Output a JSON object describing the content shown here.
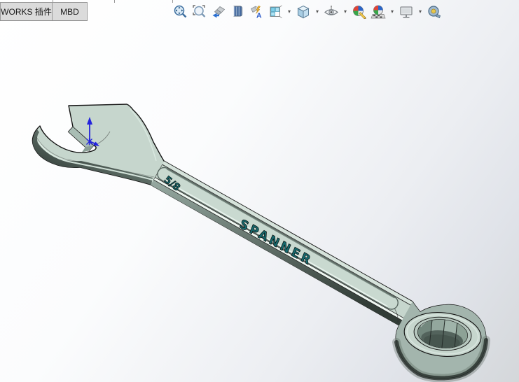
{
  "tab_bar": {
    "tabs": [
      {
        "label": "WORKS 插件"
      },
      {
        "label": "MBD"
      }
    ]
  },
  "toolbar": {
    "caret_glyph": "▾",
    "buttons": [
      {
        "icon": "zoom-to-fit-icon",
        "dropdown": false
      },
      {
        "icon": "zoom-to-area-icon",
        "dropdown": false
      },
      {
        "icon": "previous-view-icon",
        "dropdown": false
      },
      {
        "icon": "section-view-icon",
        "dropdown": false
      },
      {
        "icon": "dynamic-annotation-views-icon",
        "dropdown": false
      },
      {
        "icon": "view-orientation-icon",
        "dropdown": true
      },
      {
        "icon": "display-style-icon",
        "dropdown": true
      },
      {
        "icon": "hide-show-items-icon",
        "dropdown": true
      },
      {
        "icon": "edit-appearance-icon",
        "dropdown": false
      },
      {
        "icon": "apply-scene-icon",
        "dropdown": true
      },
      {
        "icon": "view-settings-icon",
        "dropdown": true
      },
      {
        "icon": "measure-tape-icon",
        "dropdown": false
      }
    ]
  },
  "viewport": {
    "background": {
      "top": "#ffffff",
      "bottom": "#d4d7da"
    },
    "model": {
      "name": "spanner",
      "engravings": {
        "size_label": "5/8",
        "name_label": "SPANNER"
      },
      "colors": {
        "body": "#c6d6cd",
        "edge": "#141414",
        "engraving": "#166a6f",
        "bevel_light": "#d6e3db",
        "highlight": "#eef7f1",
        "side_dark": "#3a463f"
      }
    },
    "origin_triad": {
      "color": "#2323dd"
    }
  }
}
